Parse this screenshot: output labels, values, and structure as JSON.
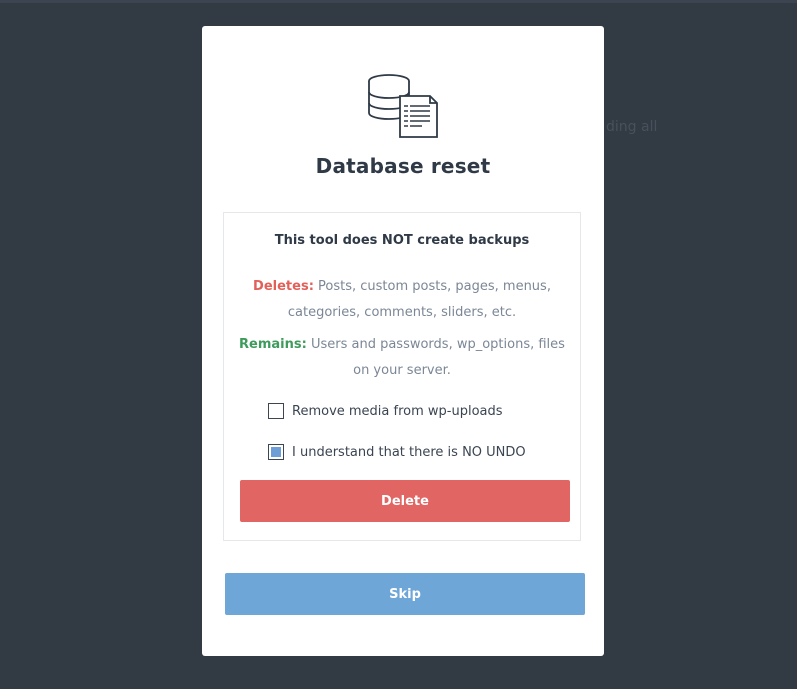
{
  "background": {
    "partial_text": "ding all"
  },
  "modal": {
    "icon": "database-document-icon",
    "title": "Database reset",
    "panel": {
      "heading": "This tool does NOT create backups",
      "deletes_label": "Deletes:",
      "deletes_text": " Posts, custom posts, pages, menus, categories, comments, sliders, etc.",
      "remains_label": "Remains:",
      "remains_text": " Users and passwords, wp_options, files on your server.",
      "options": [
        {
          "label": "Remove media from wp-uploads",
          "checked": false
        },
        {
          "label": "I understand that there is NO UNDO",
          "checked": true
        }
      ],
      "delete_label": "Delete"
    },
    "skip_label": "Skip"
  },
  "colors": {
    "backdrop": "#323a44",
    "deletes": "#e2605a",
    "remains": "#3f9b5b",
    "delete_button": "#e06563",
    "skip_button": "#6ea6d8",
    "checkbox_fill": "#6d9fd6"
  }
}
